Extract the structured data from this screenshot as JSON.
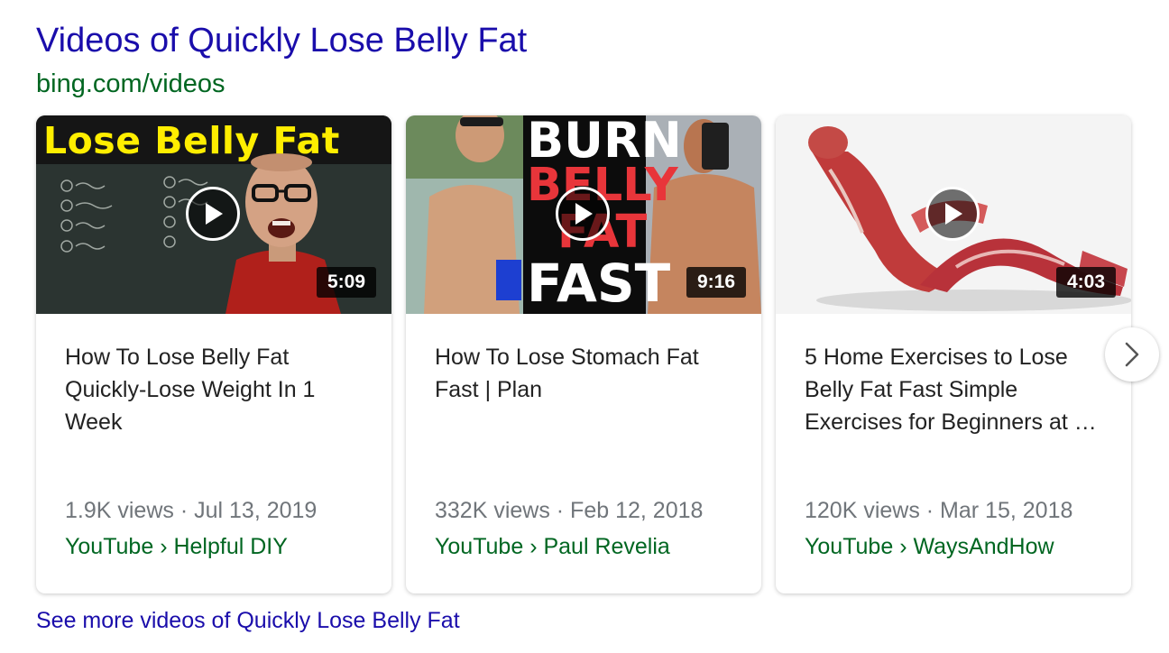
{
  "header": {
    "title": "Videos of Quickly Lose Belly Fat",
    "source": "bing.com/videos"
  },
  "videos": [
    {
      "thumb_text": [
        "Lose Belly Fat"
      ],
      "duration": "5:09",
      "title_lines": [
        "How To Lose Belly Fat",
        "Quickly-Lose Weight In 1",
        "Week"
      ],
      "meta": "1.9K views · Jul 13, 2019",
      "channel": "YouTube › Helpful DIY"
    },
    {
      "thumb_text": [
        "BURN",
        "BELLY",
        "FAT",
        "FAST"
      ],
      "duration": "9:16",
      "title_lines": [
        "How To Lose Stomach Fat",
        "Fast | Plan"
      ],
      "meta": "332K views · Feb 12, 2018",
      "channel": "YouTube › Paul Revelia"
    },
    {
      "thumb_text": [],
      "duration": "4:03",
      "title_lines": [
        "5 Home Exercises to Lose",
        "Belly Fat Fast Simple",
        "Exercises for Beginners at …"
      ],
      "meta": "120K views · Mar 15, 2018",
      "channel": "YouTube › WaysAndHow"
    }
  ],
  "see_more": "See more videos of Quickly Lose Belly Fat",
  "icons": {
    "play": "play-icon",
    "next": "chevron-right-icon"
  },
  "colors": {
    "link": "#1a0dab",
    "source_green": "#006621",
    "meta_gray": "#70757a"
  }
}
